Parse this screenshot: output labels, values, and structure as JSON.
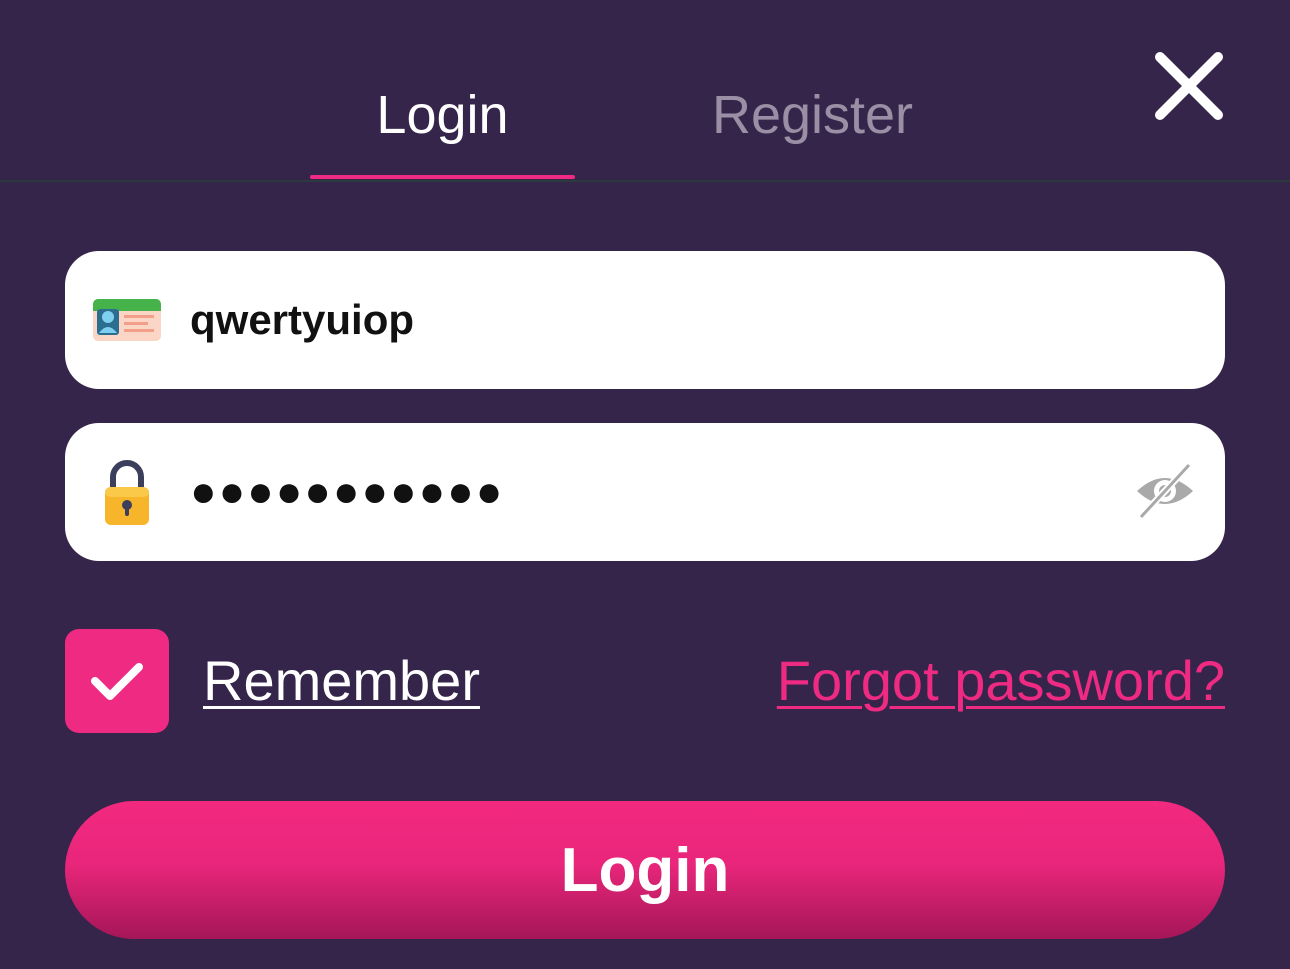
{
  "tabs": {
    "login_label": "Login",
    "register_label": "Register",
    "active": "login"
  },
  "close": {
    "icon": "close-icon"
  },
  "username": {
    "icon": "id-card-icon",
    "value": "qwertyuiop"
  },
  "password": {
    "icon": "lock-icon",
    "masked_value": "●●●●●●●●●●●",
    "toggle_icon": "eye-slash-icon"
  },
  "remember": {
    "checked": true,
    "label": "Remember",
    "icon": "check-icon"
  },
  "forgot_label": "Forgot password?",
  "submit_label": "Login",
  "colors": {
    "background": "#36254a",
    "accent": "#ef2a83",
    "inactive_tab": "#9a8fa5",
    "field_bg": "#ffffff"
  }
}
